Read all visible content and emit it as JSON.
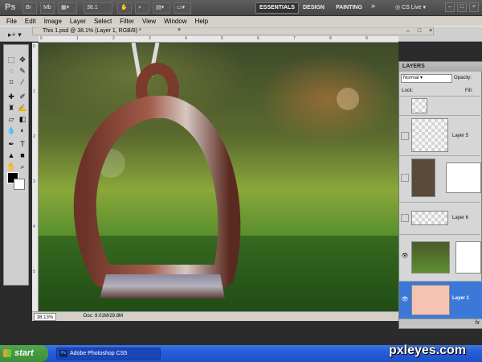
{
  "app": {
    "logo": "Ps",
    "zoom": "38.1",
    "workspaces": [
      "ESSENTIALS",
      "DESIGN",
      "PAINTING"
    ],
    "more": "»",
    "cs_live": "CS Live",
    "window_controls": [
      "–",
      "□",
      "×"
    ]
  },
  "menu": [
    "File",
    "Edit",
    "Image",
    "Layer",
    "Select",
    "Filter",
    "View",
    "Window",
    "Help"
  ],
  "options_bar": {
    "tool": "▸+ ▾"
  },
  "document": {
    "tab_title": "This 1.psd @ 38.1% (Layer 1, RGB/8) *",
    "tab_close": "×",
    "zoom_percent": "38.13%",
    "doc_info": "Doc: 9.01M/29.8M",
    "ruler_top_ticks": [
      "0",
      "1",
      "2",
      "3",
      "4",
      "5",
      "6",
      "7",
      "8",
      "9"
    ],
    "ruler_left_ticks": [
      "0",
      "1",
      "2",
      "3",
      "4",
      "5"
    ]
  },
  "layers_panel": {
    "title": "LAYERS",
    "blend_mode": "Normal",
    "opacity_label": "Opacity:",
    "lock_label": "Lock:",
    "fill_label": "Fill:",
    "fx": "fx",
    "layers": [
      {
        "name": "",
        "visible": false
      },
      {
        "name": "Layer 5",
        "visible": false
      },
      {
        "name": "",
        "visible": false
      },
      {
        "name": "Layer 6",
        "visible": false
      },
      {
        "name": "",
        "visible": true
      },
      {
        "name": "Layer 1",
        "visible": true,
        "selected": true
      }
    ]
  },
  "taskbar": {
    "start": "start",
    "task_item": "Adobe Photoshop CS5"
  },
  "watermark": "pxleyes.com"
}
